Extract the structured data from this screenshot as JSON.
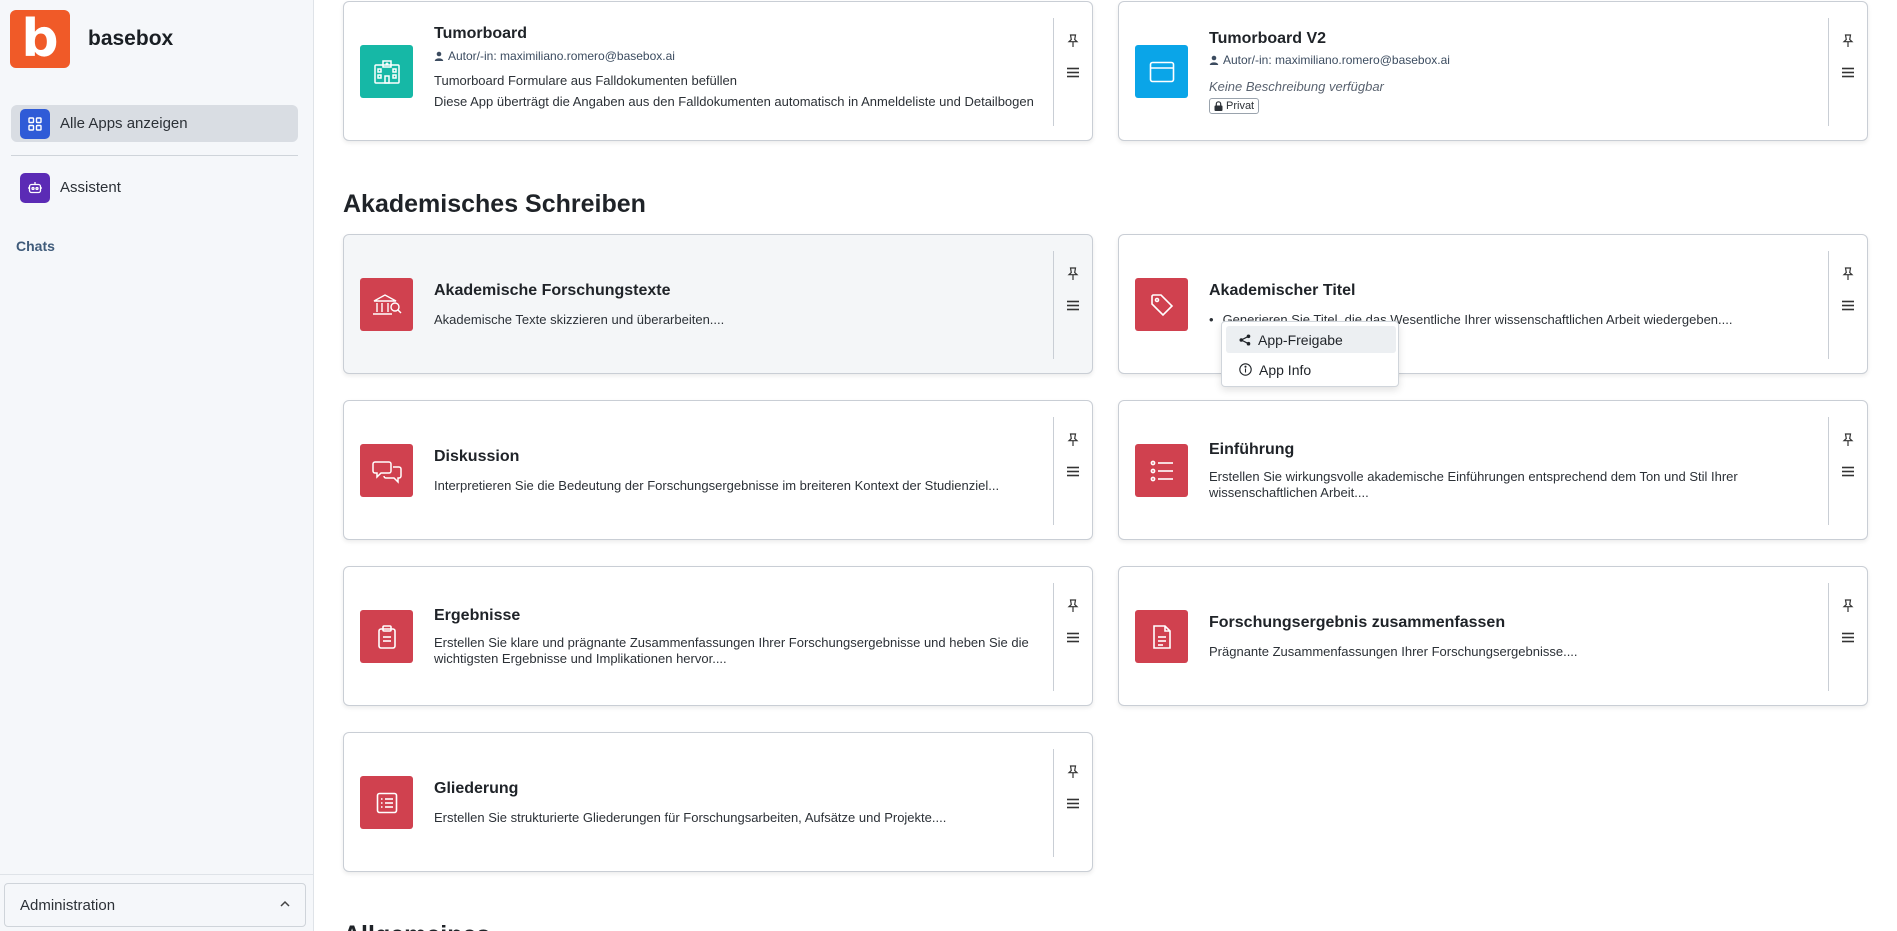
{
  "brand": {
    "logo_letter": "b",
    "name": "basebox",
    "logo_color": "#f05a28"
  },
  "sidebar": {
    "items": [
      {
        "label": "Alle Apps anzeigen",
        "icon": "grid-icon"
      },
      {
        "label": "Assistent",
        "icon": "robot-icon"
      }
    ],
    "section_label": "Chats",
    "admin": {
      "label": "Administration"
    }
  },
  "sections": [
    {
      "heading": "Akademisches Schreiben"
    },
    {
      "heading": "Allgemeines"
    }
  ],
  "cards": {
    "tumorboard": {
      "title": "Tumorboard",
      "author": "Autor/-in: maximiliano.romero@basebox.ai",
      "desc1": "Tumorboard Formulare aus Falldokumenten befüllen",
      "desc2": "Diese App überträgt die Angaben aus den Falldokumenten automatisch in Anmeldeliste und Detailbogen",
      "icon_color": "#16b8a6"
    },
    "tumorboard_v2": {
      "title": "Tumorboard V2",
      "author": "Autor/-in: maximiliano.romero@basebox.ai",
      "desc": "Keine Beschreibung verfügbar",
      "badge": "Privat",
      "icon_color": "#0aa5e8"
    },
    "forschungstexte": {
      "title": "Akademische Forschungstexte",
      "desc": "Akademische Texte skizzieren und überarbeiten...."
    },
    "titel": {
      "title": "Akademischer Titel",
      "desc": "Generieren Sie Titel, die das Wesentliche Ihrer wissenschaftlichen Arbeit wiedergeben...."
    },
    "diskussion": {
      "title": "Diskussion",
      "desc": "Interpretieren Sie die Bedeutung der Forschungsergebnisse im breiteren Kontext der Studienziel..."
    },
    "einfuehrung": {
      "title": "Einführung",
      "desc": "Erstellen Sie wirkungsvolle akademische Einführungen entsprechend dem Ton und Stil Ihrer wissenschaftlichen Arbeit...."
    },
    "ergebnisse": {
      "title": "Ergebnisse",
      "desc": "Erstellen Sie klare und prägnante Zusammenfassungen Ihrer Forschungsergebnisse und heben Sie die wichtigsten Ergebnisse und Implikationen hervor...."
    },
    "zusammenfassen": {
      "title": "Forschungsergebnis zusammenfassen",
      "desc": "Prägnante Zusammenfassungen Ihrer Forschungsergebnisse...."
    },
    "gliederung": {
      "title": "Gliederung",
      "desc": "Erstellen Sie strukturierte Gliederungen für Forschungsarbeiten, Aufsätze und Projekte...."
    }
  },
  "academic_icon_color": "#d0414f",
  "dropdown": {
    "items": [
      {
        "label": "App-Freigabe",
        "icon": "share-icon"
      },
      {
        "label": "App Info",
        "icon": "info-icon"
      }
    ]
  }
}
